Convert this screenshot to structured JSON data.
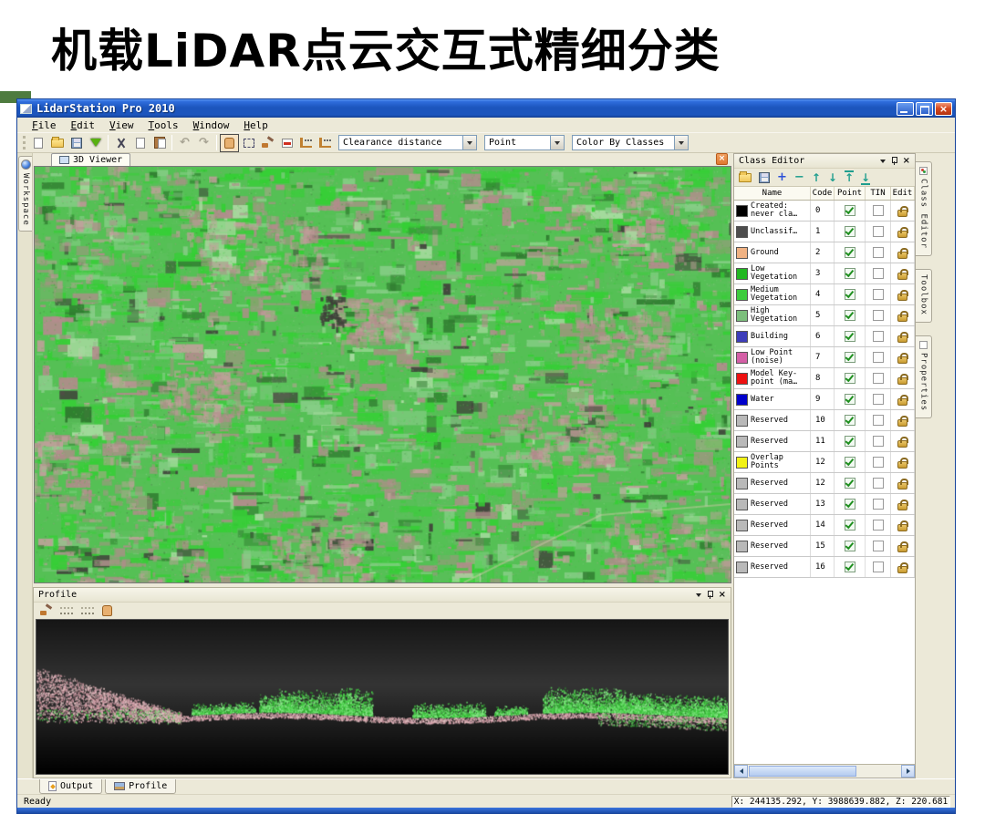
{
  "slide": {
    "title": "机载LiDAR点云交互式精细分类",
    "accent_color": "#4e7b3f"
  },
  "app": {
    "title": "LidarStation Pro 2010",
    "menu": [
      "File",
      "Edit",
      "View",
      "Tools",
      "Window",
      "Help"
    ],
    "toolbar": {
      "combos": [
        {
          "label": "Clearance distance"
        },
        {
          "label": "Point"
        },
        {
          "label": "Color By Classes"
        }
      ],
      "icons": [
        "new-file",
        "open-folder",
        "save",
        "import-arrow",
        "cut",
        "copy",
        "paste",
        "undo",
        "redo",
        "pan-hand",
        "rect-select",
        "brush",
        "slice",
        "profile-tool",
        "profile-tool-2"
      ]
    },
    "titlebar_color": "#1c55bd"
  },
  "workspace_tab": {
    "label": "Workspace"
  },
  "doc_tab": {
    "label": "3D Viewer"
  },
  "profile_panel": {
    "title": "Profile"
  },
  "class_editor": {
    "title": "Class Editor",
    "columns": [
      "Name",
      "Code",
      "Point",
      "TIN",
      "Edit"
    ],
    "rows": [
      {
        "color": "#000000",
        "name": "Created: never cla…",
        "code": "0",
        "point": true,
        "tin": false,
        "locked": true
      },
      {
        "color": "#4d4d4d",
        "name": "Unclassif…",
        "code": "1",
        "point": true,
        "tin": false,
        "locked": true
      },
      {
        "color": "#f0b283",
        "name": "Ground",
        "code": "2",
        "point": true,
        "tin": false,
        "locked": true
      },
      {
        "color": "#22b822",
        "name": "Low Vegetation",
        "code": "3",
        "point": true,
        "tin": false,
        "locked": true
      },
      {
        "color": "#3dcc3d",
        "name": "Medium Vegetation",
        "code": "4",
        "point": true,
        "tin": false,
        "locked": true
      },
      {
        "color": "#7cbf7c",
        "name": "High Vegetation",
        "code": "5",
        "point": true,
        "tin": false,
        "locked": true
      },
      {
        "color": "#3d3dba",
        "name": "Building",
        "code": "6",
        "point": true,
        "tin": false,
        "locked": true
      },
      {
        "color": "#d45fa6",
        "name": "Low Point (noise)",
        "code": "7",
        "point": true,
        "tin": false,
        "locked": true
      },
      {
        "color": "#ee1111",
        "name": "Model Key-point (ma…",
        "code": "8",
        "point": true,
        "tin": false,
        "locked": true
      },
      {
        "color": "#0000cc",
        "name": "Water",
        "code": "9",
        "point": true,
        "tin": false,
        "locked": true
      },
      {
        "color": "#b9b9b9",
        "name": "Reserved",
        "code": "10",
        "point": true,
        "tin": false,
        "locked": true
      },
      {
        "color": "#b9b9b9",
        "name": "Reserved",
        "code": "11",
        "point": true,
        "tin": false,
        "locked": true
      },
      {
        "color": "#f2f215",
        "name": "Overlap Points",
        "code": "12",
        "point": true,
        "tin": false,
        "locked": true
      },
      {
        "color": "#b9b9b9",
        "name": "Reserved",
        "code": "12",
        "point": true,
        "tin": false,
        "locked": true
      },
      {
        "color": "#b9b9b9",
        "name": "Reserved",
        "code": "13",
        "point": true,
        "tin": false,
        "locked": true
      },
      {
        "color": "#b9b9b9",
        "name": "Reserved",
        "code": "14",
        "point": true,
        "tin": false,
        "locked": true
      },
      {
        "color": "#b9b9b9",
        "name": "Reserved",
        "code": "15",
        "point": true,
        "tin": false,
        "locked": true
      },
      {
        "color": "#b9b9b9",
        "name": "Reserved",
        "code": "16",
        "point": true,
        "tin": false,
        "locked": true
      }
    ]
  },
  "right_tabs": [
    {
      "label": "Class Editor"
    },
    {
      "label": "Toolbox"
    },
    {
      "label": "Properties"
    }
  ],
  "bottom_tabs": [
    {
      "label": "Output"
    },
    {
      "label": "Profile"
    }
  ],
  "status": {
    "ready": "Ready",
    "coords": "X: 244135.292, Y: 3988639.882, Z: 220.681"
  },
  "main_viewer": {
    "palette": {
      "base": "#55c055",
      "greens": [
        "#35cf35",
        "#5cbf5c",
        "#86cd86",
        "#a9dba1"
      ],
      "mauves": [
        "#b28c8c",
        "#c2a09c"
      ],
      "dark_green": "#2f7a2f",
      "dark": "#40413a"
    }
  },
  "profile_view": {
    "palette": {
      "bg_top": "#161616",
      "bg_mid": "#343434",
      "bg_bottom": "#000000",
      "ground": [
        "#d9a8b4",
        "#c89098",
        "#e0c0c0"
      ],
      "veg": [
        "#44d044",
        "#63de63",
        "#2fa62f",
        "#8fe88f"
      ]
    }
  }
}
